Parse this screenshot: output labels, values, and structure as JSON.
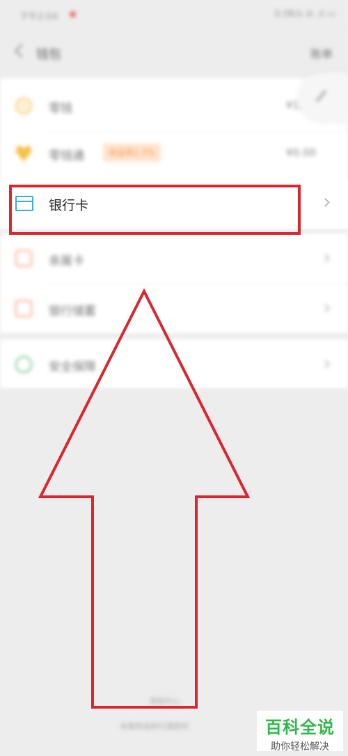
{
  "status_bar": {
    "time": "下午2:04",
    "right": "0.0K/s ⊖ .ıl ▭"
  },
  "nav": {
    "title": "钱包",
    "right": "账单"
  },
  "section1": [
    {
      "label": "零钱",
      "value": "¥131.",
      "badge": ""
    },
    {
      "label": "零钱通",
      "value": "¥0.00",
      "badge": "收益率2.3%"
    }
  ],
  "bank_card": {
    "label": "银行卡"
  },
  "section2": [
    {
      "label": "亲属卡"
    },
    {
      "label": "银行储蓄"
    }
  ],
  "section3": [
    {
      "label": "安全保障"
    }
  ],
  "footer": {
    "line1": "帮助中心",
    "line2": "本服务由财付通提供"
  },
  "watermark": {
    "title": "百科全说",
    "subtitle": "助你轻松解决"
  },
  "colors": {
    "highlight": "#d9262f",
    "watermark_green": "#2fb84a"
  }
}
